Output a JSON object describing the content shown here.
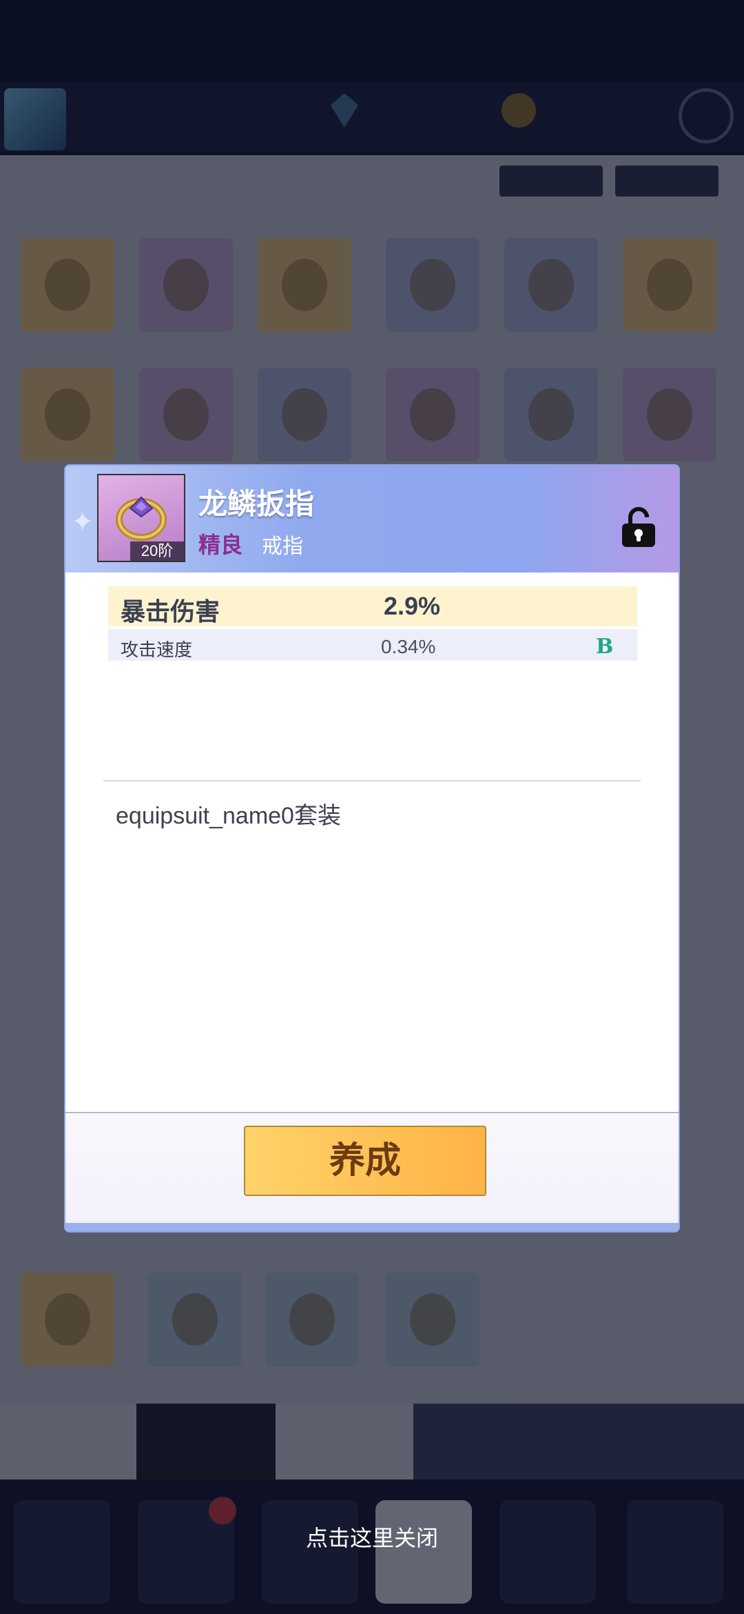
{
  "item": {
    "name": "龙鳞扳指",
    "quality": "精良",
    "type": "戒指",
    "tier": "20阶",
    "locked": false
  },
  "stats": {
    "main": {
      "label": "暴击伤害",
      "value": "2.9%"
    },
    "sub": [
      {
        "label": "攻击速度",
        "value": "0.34%",
        "grade": "B"
      }
    ]
  },
  "suit": {
    "name": "equipsuit_name0套装"
  },
  "actions": {
    "cultivate_label": "养成"
  },
  "overlay": {
    "close_hint": "点击这里关闭"
  },
  "colors": {
    "quality_purple": "#8b2d8f",
    "grade_green": "#20a48a",
    "header_blue": "#8fa8ee",
    "button_gold": "#ffc155"
  },
  "icons": {
    "item": "ring-icon",
    "lock": "unlocked-padlock-icon",
    "decor": "sparkle-icon"
  }
}
